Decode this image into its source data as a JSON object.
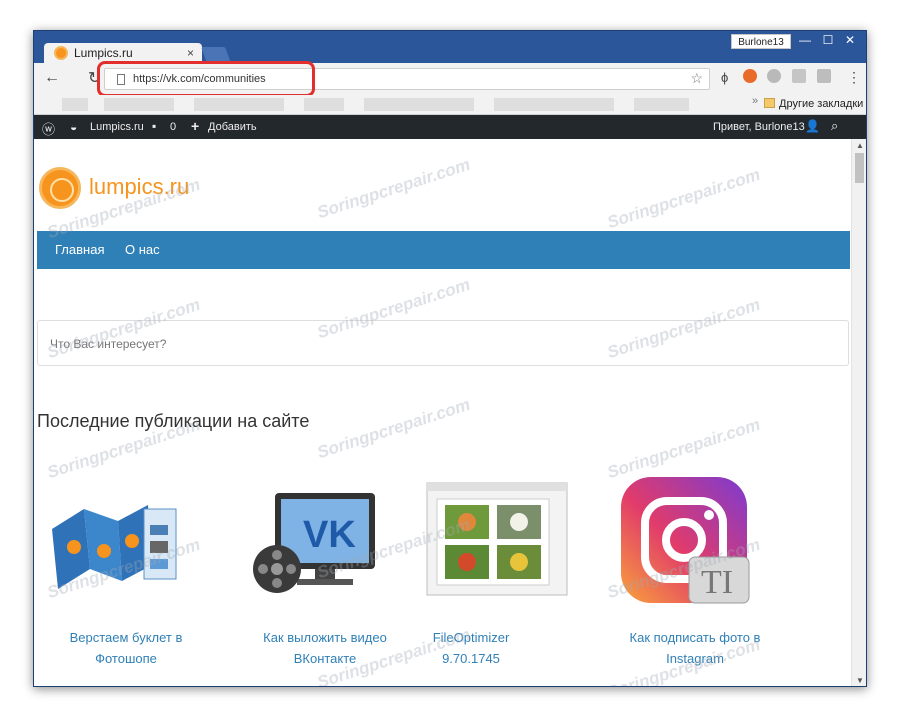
{
  "browser": {
    "tab_title": "Lumpics.ru",
    "tab_close": "×",
    "user_badge": "Burlone13",
    "address": "https://vk.com/communities",
    "other_bookmarks": "Другие закладки"
  },
  "admin_bar": {
    "site_name": "Lumpics.ru",
    "comments_count": "0",
    "add_label": "Добавить",
    "greeting": "Привет, Burlone13"
  },
  "site": {
    "logo_text": "lumpics.ru",
    "nav": [
      "Главная",
      "О нас"
    ],
    "search_placeholder": "Что Вас интересует?",
    "section_title": "Последние публикации на сайте",
    "posts": [
      {
        "line1": "Верстаем буклет в",
        "line2": "Фотошопе"
      },
      {
        "line1": "Как выложить видео",
        "line2": "ВКонтакте"
      },
      {
        "line1": "FileOptimizer",
        "line2": "9.70.1745"
      },
      {
        "line1": "Как подписать фото в",
        "line2": "Instagram"
      }
    ]
  },
  "watermark_text": "Soringpcrepair.com",
  "colors": {
    "titlebar": "#2b579a",
    "nav_blue": "#2f80b7",
    "orange": "#f7941d",
    "highlight_red": "#e32e2e"
  }
}
